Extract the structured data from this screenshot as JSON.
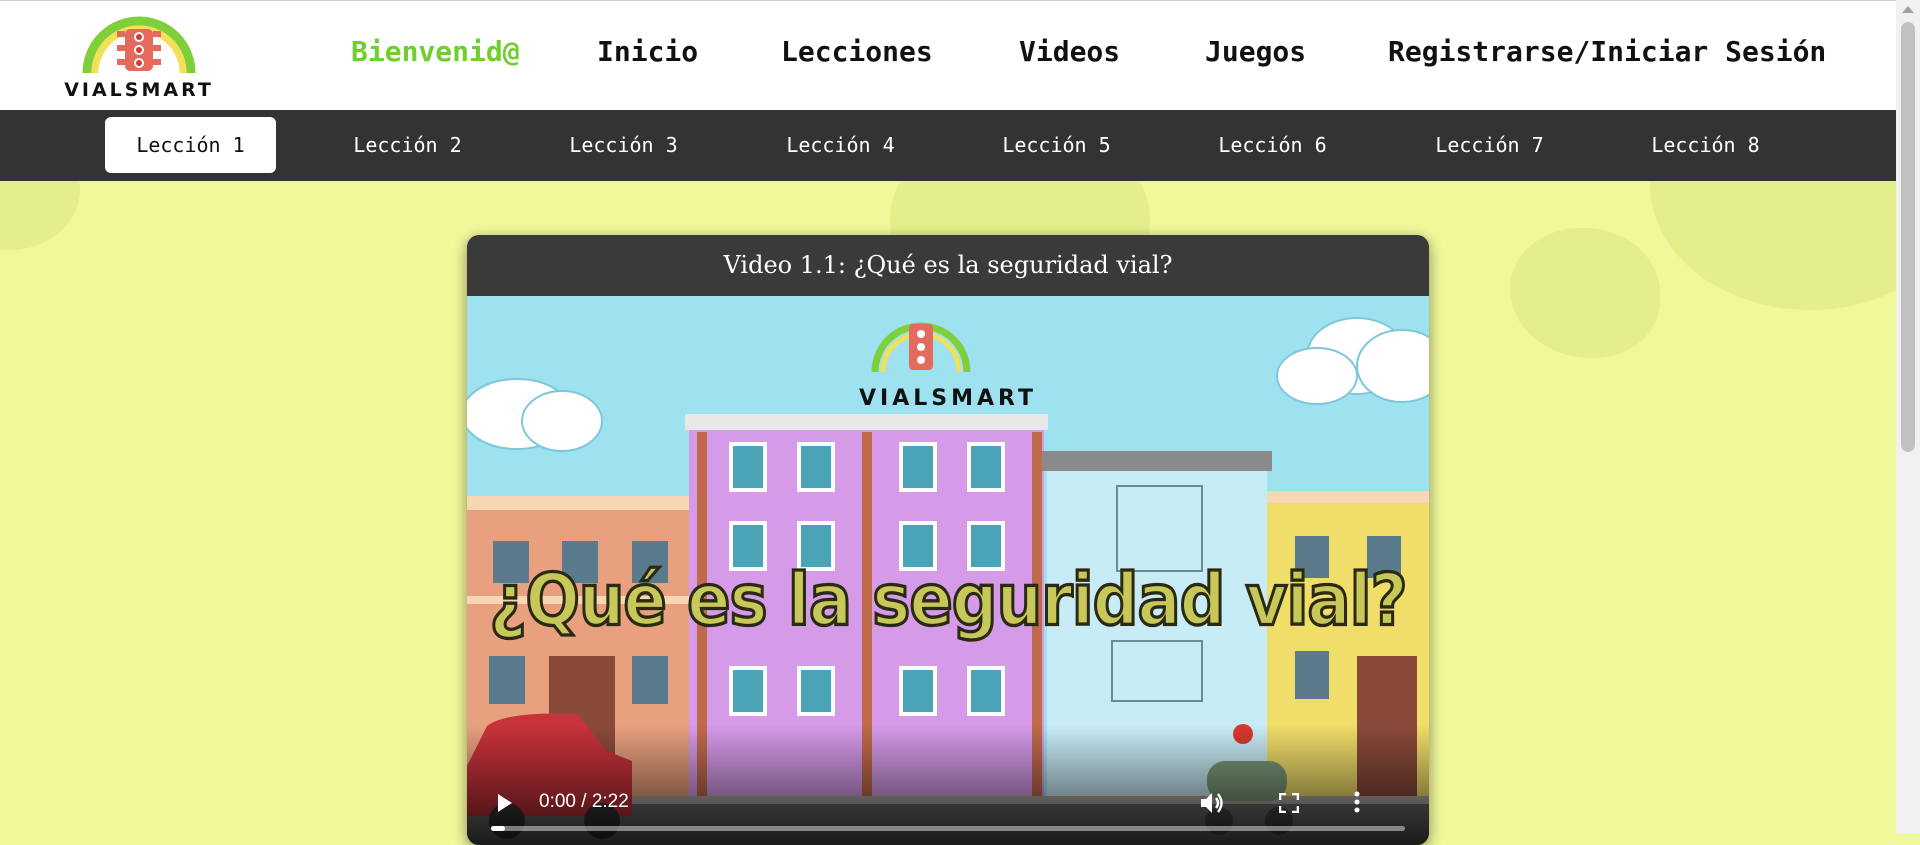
{
  "brand": {
    "name": "VIALSMART"
  },
  "nav": {
    "items": [
      {
        "label": "Bienvenid@",
        "active": true
      },
      {
        "label": "Inicio",
        "active": false
      },
      {
        "label": "Lecciones",
        "active": false
      },
      {
        "label": "Videos",
        "active": false
      },
      {
        "label": "Juegos",
        "active": false
      },
      {
        "label": "Registrarse/Iniciar Sesión",
        "active": false
      }
    ]
  },
  "lessons": {
    "items": [
      "Lección 1",
      "Lección 2",
      "Lección 3",
      "Lección 4",
      "Lección 5",
      "Lección 6",
      "Lección 7",
      "Lección 8"
    ],
    "selected": "Lección 1"
  },
  "video": {
    "title": "Video 1.1: ¿Qué es la seguridad vial?",
    "headline": "¿Qué es la seguridad vial?",
    "brand_overlay": "VIALSMART",
    "time": "0:00 / 2:22",
    "progress_fraction": 0.0
  },
  "colors": {
    "accent": "#6fcf2f",
    "page_background": "#f0f89a",
    "lesson_bar": "#333333"
  },
  "icons": {
    "play": "play-icon",
    "volume": "volume-icon",
    "fullscreen": "fullscreen-icon",
    "more": "more-vertical-icon",
    "logo": "traffic-light-icon"
  }
}
